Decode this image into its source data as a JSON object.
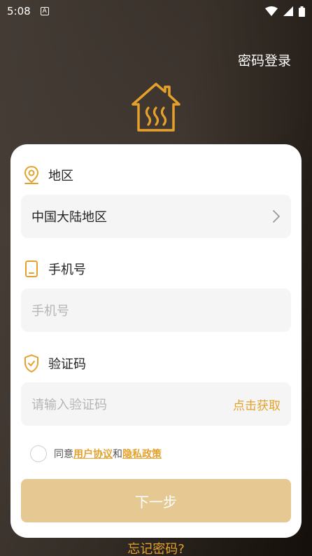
{
  "status_bar": {
    "time": "5:08",
    "notif": "A"
  },
  "header": {
    "password_login": "密码登录"
  },
  "region": {
    "label": "地区",
    "value": "中国大陆地区"
  },
  "phone": {
    "label": "手机号",
    "placeholder": "手机号"
  },
  "code": {
    "label": "验证码",
    "placeholder": "请输入验证码",
    "get_code": "点击获取"
  },
  "agreement": {
    "prefix": "同意",
    "user_agreement": "用户协议",
    "and": "和",
    "privacy_policy": "隐私政策"
  },
  "next_button": "下一步",
  "forgot_password": "忘记密码?",
  "colors": {
    "accent": "#e5a12c",
    "button": "#e5c892",
    "field_bg": "#f5f5f5"
  },
  "icons": [
    "location-pin-icon",
    "phone-icon",
    "shield-check-icon",
    "chevron-right-icon",
    "home-heat-logo-icon"
  ]
}
